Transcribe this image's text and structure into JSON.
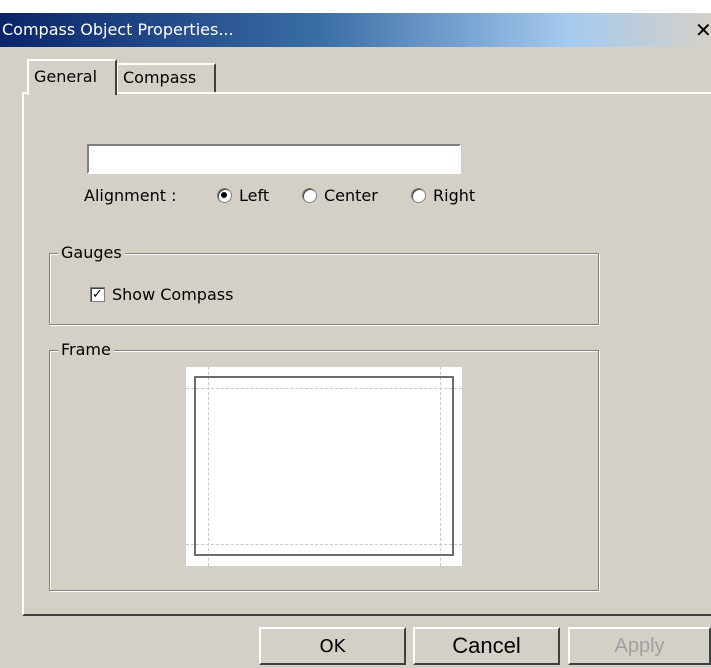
{
  "window": {
    "title": "Compass Object Properties...",
    "close_glyph": "✕"
  },
  "tabs": [
    {
      "label": "General"
    },
    {
      "label": "Compass"
    }
  ],
  "general": {
    "text_value": "",
    "alignment_label": "Alignment :",
    "alignment_options": [
      {
        "label": "Left",
        "selected": true
      },
      {
        "label": "Center",
        "selected": false
      },
      {
        "label": "Right",
        "selected": false
      }
    ]
  },
  "gauges": {
    "title": "Gauges",
    "show_compass_label": "Show Compass",
    "show_compass_checked": true
  },
  "frame": {
    "title": "Frame"
  },
  "buttons": {
    "ok": "OK",
    "cancel": "Cancel",
    "apply": "Apply"
  }
}
